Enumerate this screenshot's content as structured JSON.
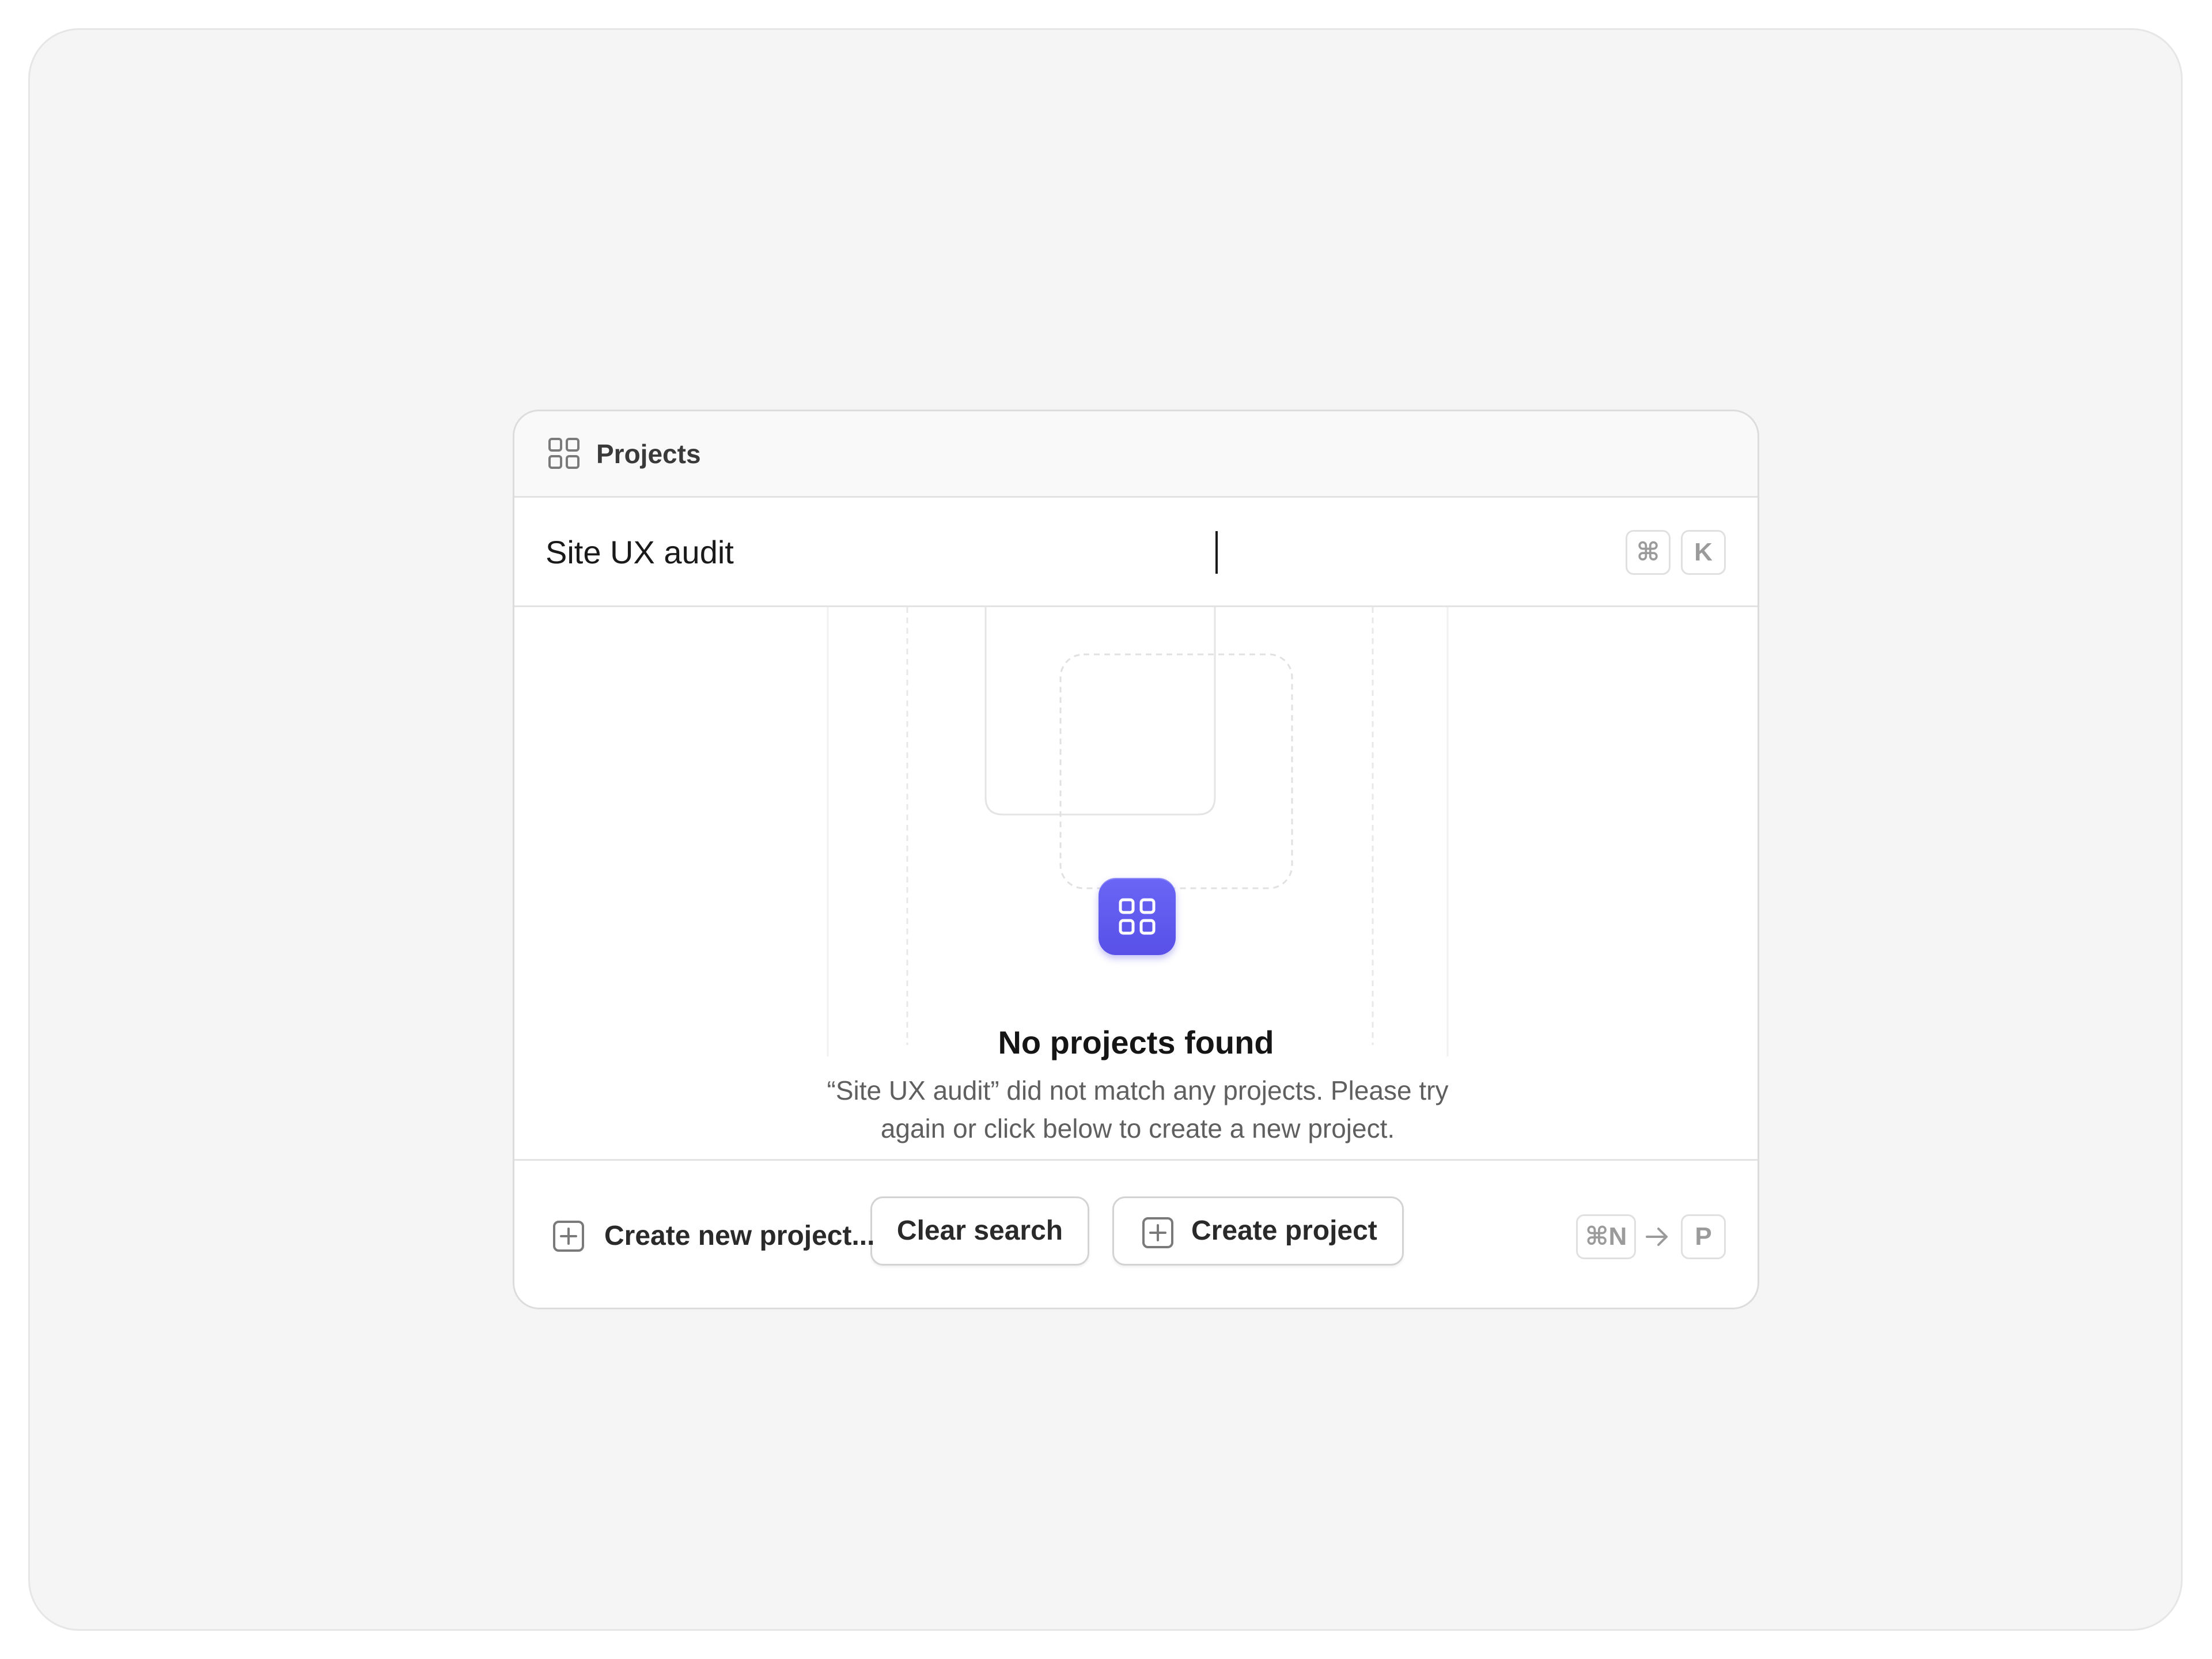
{
  "dialog": {
    "header": {
      "title": "Projects",
      "icon": "grid-icon"
    },
    "search": {
      "value": "Site UX audit",
      "shortcut_keys": [
        "⌘",
        "K"
      ]
    },
    "empty_state": {
      "icon": "grid-icon",
      "title": "No projects found",
      "description": "“Site UX audit” did not match any projects. Please try again or click below to create a new project.",
      "clear_button_label": "Clear search",
      "create_button_label": "Create project",
      "create_button_icon": "plus-square-icon"
    },
    "footer": {
      "action_label": "Create new project...",
      "action_icon": "plus-square-icon",
      "shortcut_first": "⌘N",
      "shortcut_separator_icon": "arrow-right-icon",
      "shortcut_second": "P"
    }
  },
  "colors": {
    "accent": "#5b54ec",
    "background": "#f5f5f5",
    "surface": "#ffffff",
    "border": "#dcdcdc"
  }
}
